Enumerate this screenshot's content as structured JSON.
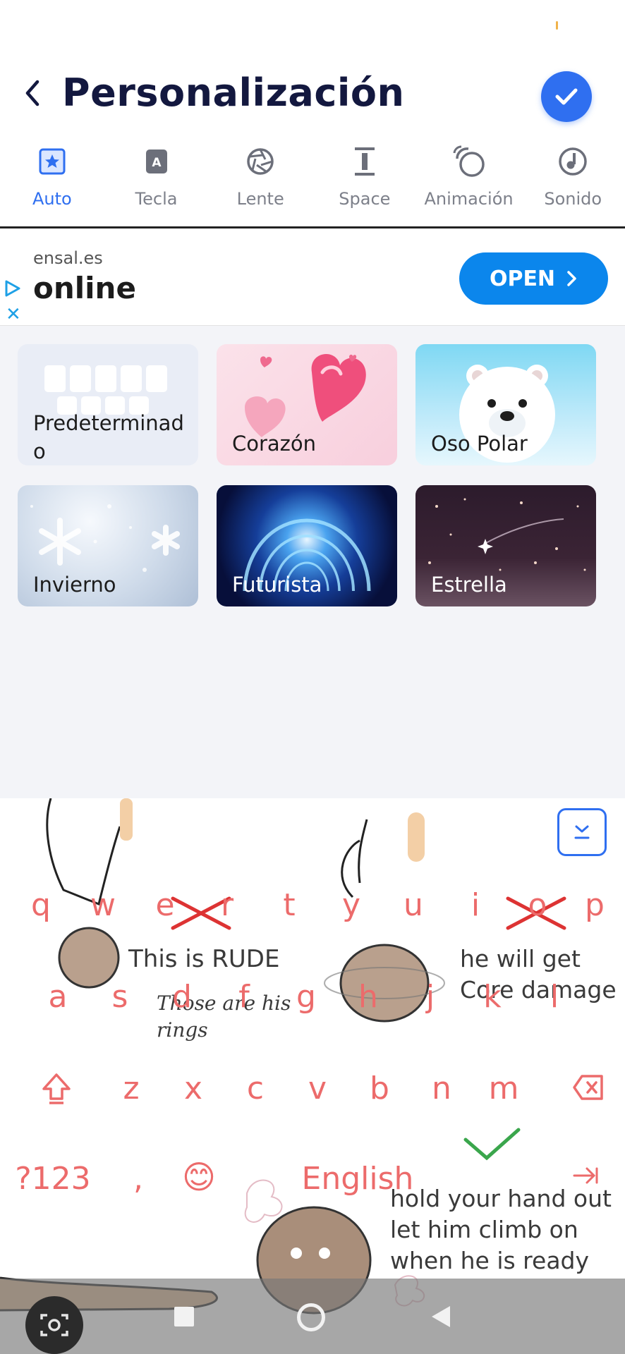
{
  "header": {
    "title": "Personalización"
  },
  "tabs": [
    {
      "label": "Auto",
      "icon": "star-square-icon",
      "active": true
    },
    {
      "label": "Tecla",
      "icon": "key-letter-icon",
      "active": false
    },
    {
      "label": "Lente",
      "icon": "aperture-icon",
      "active": false
    },
    {
      "label": "Space",
      "icon": "space-cursor-icon",
      "active": false
    },
    {
      "label": "Animación",
      "icon": "bubbles-icon",
      "active": false
    },
    {
      "label": "Sonido",
      "icon": "music-note-icon",
      "active": false
    }
  ],
  "ad": {
    "domain": "ensal.es",
    "title": "online",
    "cta": "OPEN"
  },
  "themes": [
    {
      "name": "Predeterminad\no"
    },
    {
      "name": "Corazón"
    },
    {
      "name": "Oso Polar"
    },
    {
      "name": "Invierno"
    },
    {
      "name": "Futurista"
    },
    {
      "name": "Estrella"
    }
  ],
  "keyboard": {
    "row1": [
      "q",
      "w",
      "e",
      "r",
      "t",
      "y",
      "u",
      "i",
      "o",
      "p"
    ],
    "row2": [
      "a",
      "s",
      "d",
      "f",
      "g",
      "h",
      "j",
      "k",
      "l"
    ],
    "row3": [
      "z",
      "x",
      "c",
      "v",
      "b",
      "n",
      "m"
    ],
    "symbols_key": "?123",
    "comma_key": ",",
    "space_label": "English",
    "emoji": "😊",
    "background_texts": {
      "rude": "This is RUDE",
      "rings": "Those are his\nrings",
      "damage": "he will get\nCore damage",
      "hand": "hold your hand out\nlet him climb on\nwhen he is ready"
    }
  },
  "colors": {
    "accent": "#2f6ff0",
    "key_text": "#ec6b6b",
    "title": "#13183f"
  }
}
